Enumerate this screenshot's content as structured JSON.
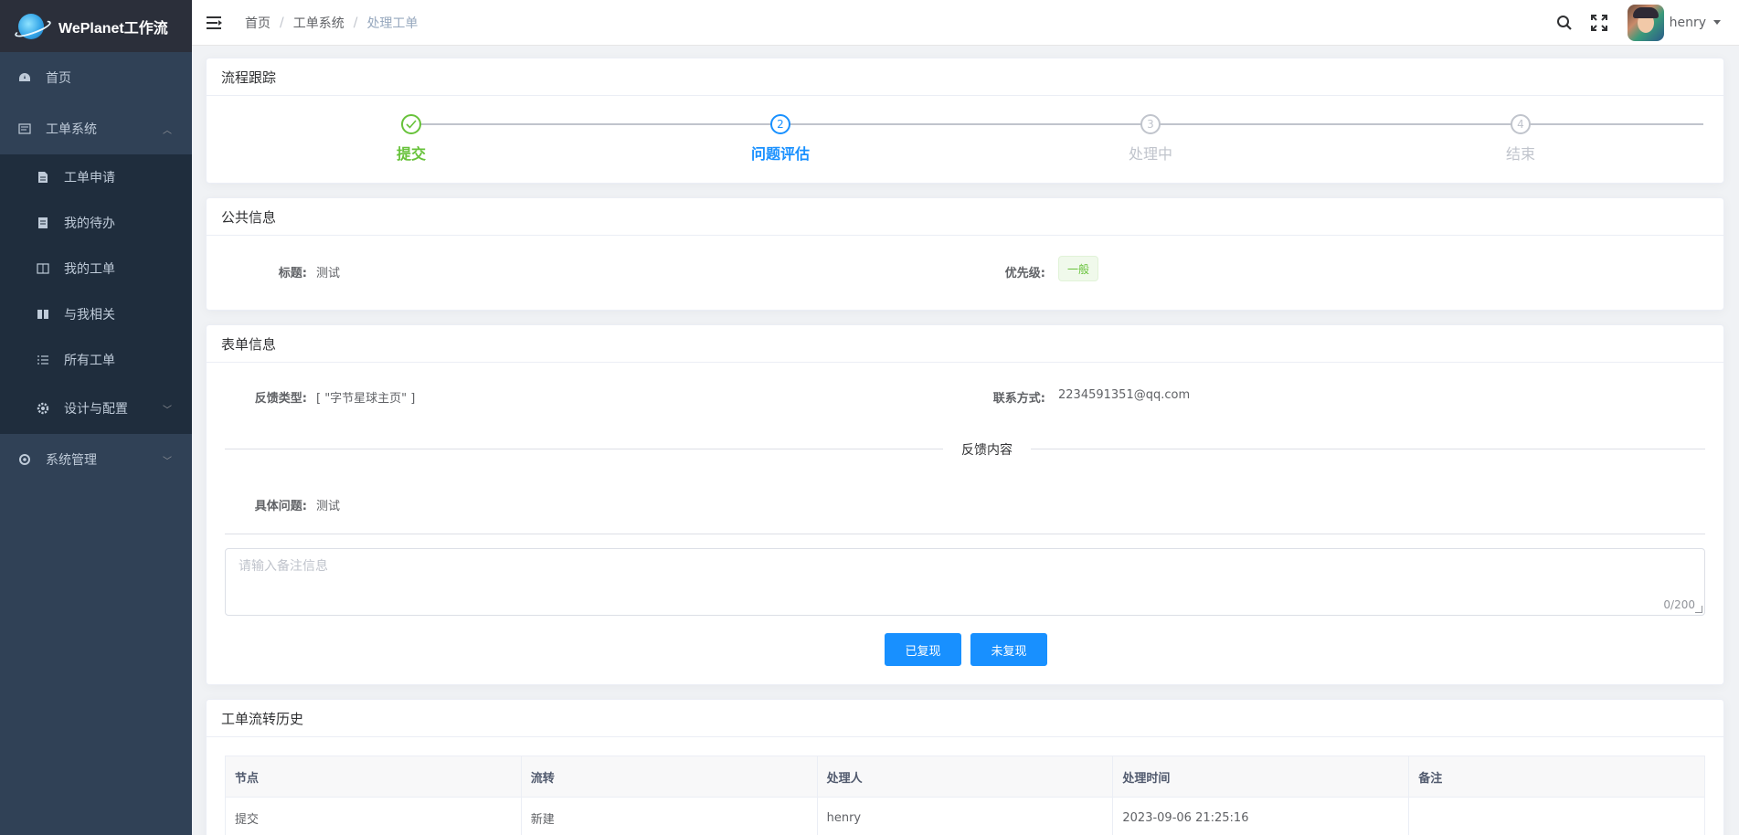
{
  "app": {
    "name": "WePlanet工作流"
  },
  "sidebar": {
    "items": [
      {
        "label": "首页",
        "icon": "dashboard-icon"
      },
      {
        "label": "工单系统",
        "icon": "ticket-system-icon",
        "expanded": true,
        "children": [
          {
            "label": "工单申请",
            "icon": "form-edit-icon"
          },
          {
            "label": "我的待办",
            "icon": "todo-icon"
          },
          {
            "label": "我的工单",
            "icon": "my-ticket-icon"
          },
          {
            "label": "与我相关",
            "icon": "related-icon"
          },
          {
            "label": "所有工单",
            "icon": "list-icon"
          },
          {
            "label": "设计与配置",
            "icon": "gear-icon",
            "expanded": false
          }
        ]
      },
      {
        "label": "系统管理",
        "icon": "system-icon",
        "expanded": false
      }
    ]
  },
  "header": {
    "breadcrumb": [
      "首页",
      "工单系统",
      "处理工单"
    ],
    "username": "henry"
  },
  "process": {
    "title": "流程跟踪",
    "steps": [
      {
        "number": "1",
        "label": "提交",
        "status": "success"
      },
      {
        "number": "2",
        "label": "问题评估",
        "status": "process"
      },
      {
        "number": "3",
        "label": "处理中",
        "status": "wait"
      },
      {
        "number": "4",
        "label": "结束",
        "status": "wait"
      }
    ]
  },
  "public_info": {
    "title": "公共信息",
    "title_label": "标题:",
    "title_value": "测试",
    "priority_label": "优先级:",
    "priority_value": "一般"
  },
  "form_info": {
    "title": "表单信息",
    "feedback_type_label": "反馈类型:",
    "feedback_type_value": "[ \"字节星球主页\" ]",
    "contact_label": "联系方式:",
    "contact_value": "2234591351@qq.com",
    "divider_text": "反馈内容",
    "issue_label": "具体问题:",
    "issue_value": "测试",
    "remark_placeholder": "请输入备注信息",
    "remark_count": "0/200",
    "btn_reproduced": "已复现",
    "btn_not_reproduced": "未复现"
  },
  "history": {
    "title": "工单流转历史",
    "columns": [
      "节点",
      "流转",
      "处理人",
      "处理时间",
      "备注"
    ],
    "rows": [
      [
        "提交",
        "新建",
        "henry",
        "2023-09-06 21:25:16",
        ""
      ]
    ]
  },
  "colors": {
    "sidebar_bg": "#304156",
    "submenu_bg": "#1f2d3d",
    "primary": "#1890ff",
    "success": "#67c23a"
  }
}
